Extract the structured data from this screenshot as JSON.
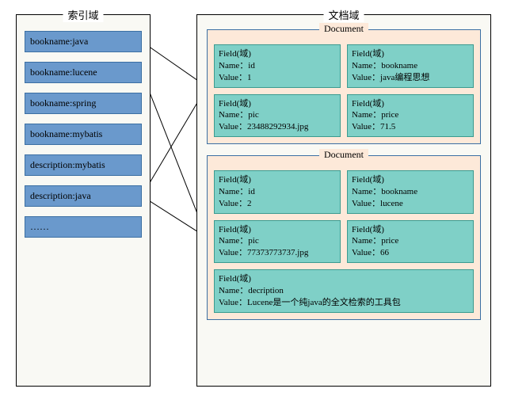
{
  "index_panel": {
    "title": "索引域",
    "items": [
      "bookname:java",
      "bookname:lucene",
      "bookname:spring",
      "bookname:mybatis",
      "description:mybatis",
      "description:java",
      "……"
    ]
  },
  "doc_panel": {
    "title": "文档域",
    "documents": [
      {
        "title": "Document",
        "fields": [
          {
            "header": "Field(域)",
            "name_label": "Name：id",
            "value_label": "Value：1"
          },
          {
            "header": "Field(域)",
            "name_label": "Name：bookname",
            "value_label": "Value：java编程思想"
          },
          {
            "header": "Field(域)",
            "name_label": "Name：pic",
            "value_label": "Value：23488292934.jpg"
          },
          {
            "header": "Field(域)",
            "name_label": "Name：price",
            "value_label": "Value：71.5"
          }
        ]
      },
      {
        "title": "Document",
        "fields": [
          {
            "header": "Field(域)",
            "name_label": "Name：id",
            "value_label": "Value：2"
          },
          {
            "header": "Field(域)",
            "name_label": "Name：bookname",
            "value_label": "Value：lucene"
          },
          {
            "header": "Field(域)",
            "name_label": "Name：pic",
            "value_label": "Value：77373773737.jpg"
          },
          {
            "header": "Field(域)",
            "name_label": "Name：price",
            "value_label": "Value：66"
          },
          {
            "header": "Field(域)",
            "name_label": "Name：decription",
            "value_label": "Value：Lucene是一个纯java的全文检索的工具包"
          }
        ]
      }
    ]
  },
  "arrows": [
    {
      "from": "index-0",
      "to": "doc-0"
    },
    {
      "from": "index-5",
      "to": "doc-0"
    },
    {
      "from": "index-1",
      "to": "doc-1"
    },
    {
      "from": "index-5",
      "to": "doc-1"
    }
  ]
}
